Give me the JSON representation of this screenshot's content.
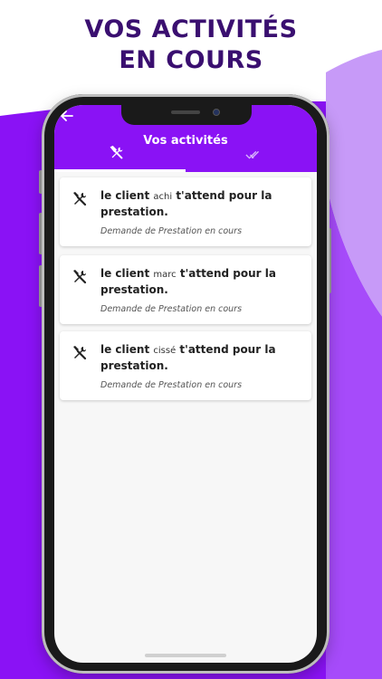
{
  "headline": {
    "line1": "VOS ACTIVITÉS",
    "line2": "EN COURS"
  },
  "colors": {
    "brand_purple": "#8a12f5",
    "headline_color": "#3a0f70",
    "wave_light": "#c79af8"
  },
  "appbar": {
    "title": "Vos activités",
    "back_icon": "arrow-left-icon",
    "tabs": [
      {
        "icon": "tools-icon",
        "active": true
      },
      {
        "icon": "double-check-icon",
        "active": false
      }
    ]
  },
  "activities": [
    {
      "prefix": "le client",
      "client": "achi",
      "suffix": "t'attend pour la prestation.",
      "status": "Demande de Prestation en cours",
      "icon": "tools-icon"
    },
    {
      "prefix": "le client",
      "client": "marc",
      "suffix": "t'attend pour la prestation.",
      "status": "Demande de Prestation en cours",
      "icon": "tools-icon"
    },
    {
      "prefix": "le client",
      "client": "cissé",
      "suffix": "t'attend pour la prestation.",
      "status": "Demande de Prestation en cours",
      "icon": "tools-icon"
    }
  ]
}
